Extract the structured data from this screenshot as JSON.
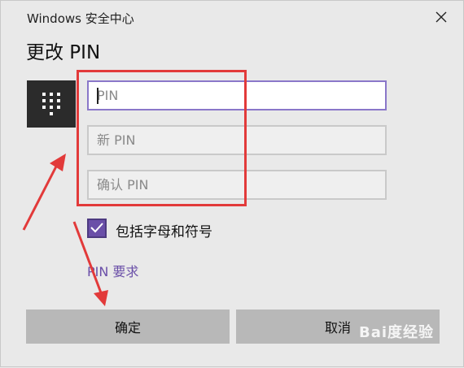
{
  "window": {
    "title": "Windows 安全中心",
    "heading": "更改 PIN"
  },
  "fields": [
    {
      "placeholder": "PIN",
      "active": true
    },
    {
      "placeholder": "新 PIN",
      "active": false
    },
    {
      "placeholder": "确认 PIN",
      "active": false
    }
  ],
  "options": {
    "include_letters_label": "包括字母和符号",
    "include_letters_checked": true,
    "pin_requirements_link": "PIN 要求"
  },
  "buttons": {
    "ok": "确定",
    "cancel": "取消"
  },
  "watermark": {
    "text": "Bai度经验"
  },
  "colors": {
    "accent": "#6a4fa8",
    "annotation": "#e23a3a",
    "button": "#b8b8b8"
  }
}
